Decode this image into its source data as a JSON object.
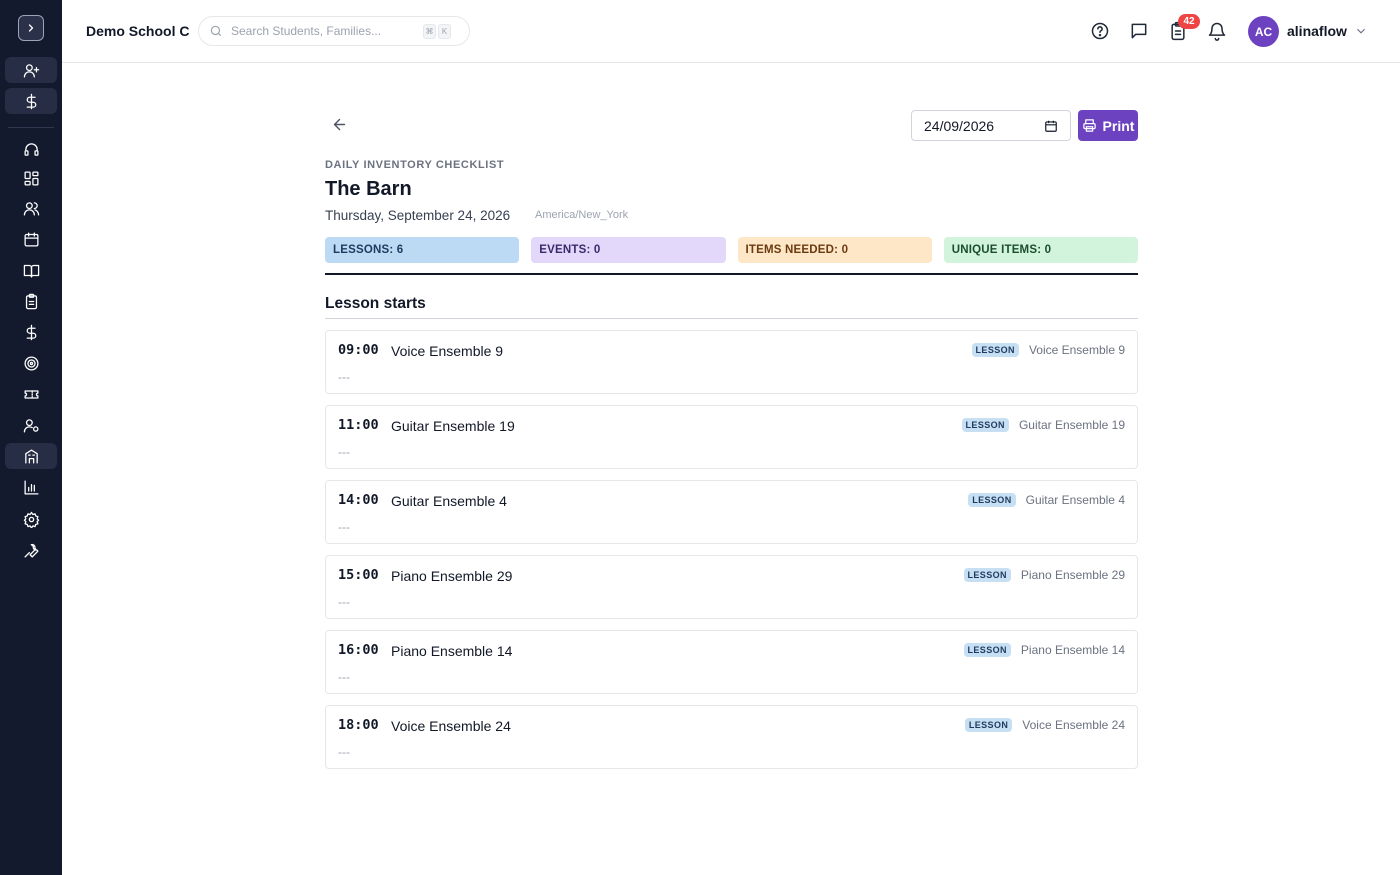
{
  "sidebar": {
    "items": [
      {
        "name": "add-user-icon"
      },
      {
        "name": "dollar-icon"
      },
      {
        "name": "headset-icon"
      },
      {
        "name": "dashboard-icon"
      },
      {
        "name": "users-icon"
      },
      {
        "name": "calendar-icon"
      },
      {
        "name": "book-icon"
      },
      {
        "name": "clipboard-icon"
      },
      {
        "name": "dollar-icon"
      },
      {
        "name": "target-icon"
      },
      {
        "name": "ticket-icon"
      },
      {
        "name": "user-settings-icon"
      },
      {
        "name": "building-icon"
      },
      {
        "name": "bar-chart-icon"
      },
      {
        "name": "gear-icon"
      },
      {
        "name": "wrench-icon"
      }
    ]
  },
  "header": {
    "school_name": "Demo School C",
    "search_placeholder": "Search Students, Families...",
    "kbd_1": "⌘",
    "kbd_2": "K",
    "notification_badge": "42",
    "avatar_initials": "AC",
    "username": "alinaflow"
  },
  "toolbar": {
    "date_value": "24/09/2026",
    "print_label": "Print"
  },
  "report": {
    "eyebrow": "DAILY INVENTORY CHECKLIST",
    "title": "The Barn",
    "date_line": "Thursday, September 24, 2026",
    "timezone": "America/New_York"
  },
  "stats": {
    "lessons": "LESSONS: 6",
    "events": "EVENTS: 0",
    "items_needed": "ITEMS NEEDED: 0",
    "unique_items": "UNIQUE ITEMS: 0"
  },
  "section": {
    "title": "Lesson starts"
  },
  "lessons": [
    {
      "time": "09:00",
      "name": "Voice Ensemble 9",
      "note": "---",
      "tag": "LESSON",
      "label": "Voice Ensemble 9"
    },
    {
      "time": "11:00",
      "name": "Guitar Ensemble 19",
      "note": "---",
      "tag": "LESSON",
      "label": "Guitar Ensemble 19"
    },
    {
      "time": "14:00",
      "name": "Guitar Ensemble 4",
      "note": "---",
      "tag": "LESSON",
      "label": "Guitar Ensemble 4"
    },
    {
      "time": "15:00",
      "name": "Piano Ensemble 29",
      "note": "---",
      "tag": "LESSON",
      "label": "Piano Ensemble 29"
    },
    {
      "time": "16:00",
      "name": "Piano Ensemble 14",
      "note": "---",
      "tag": "LESSON",
      "label": "Piano Ensemble 14"
    },
    {
      "time": "18:00",
      "name": "Voice Ensemble 24",
      "note": "---",
      "tag": "LESSON",
      "label": "Voice Ensemble 24"
    }
  ],
  "colors": {
    "sidebar_bg": "#141a2e",
    "accent": "#6d42c1",
    "badge": "#ef4444"
  }
}
